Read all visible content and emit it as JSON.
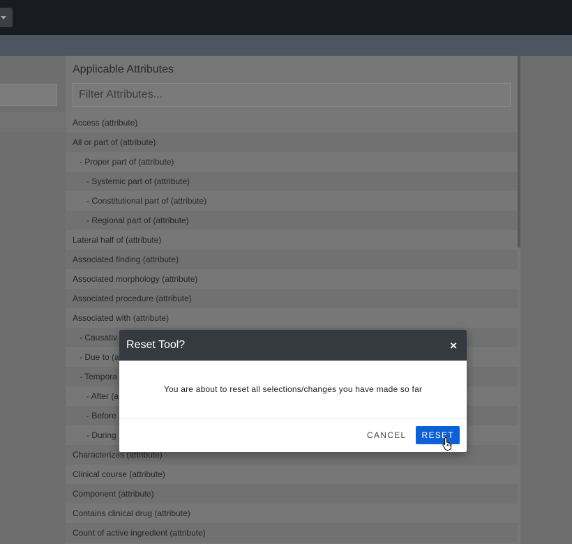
{
  "panel": {
    "title": "Applicable Attributes",
    "filter_placeholder": "Filter Attributes...",
    "items": [
      {
        "label": "Access (attribute)",
        "level": 0
      },
      {
        "label": "All or part of (attribute)",
        "level": 0
      },
      {
        "label": "- Proper part of (attribute)",
        "level": 1
      },
      {
        "label": "- Systemic part of (attribute)",
        "level": 2
      },
      {
        "label": "- Constitutional part of (attribute)",
        "level": 2
      },
      {
        "label": "- Regional part of (attribute)",
        "level": 2
      },
      {
        "label": "Lateral half of (attribute)",
        "level": 0
      },
      {
        "label": "Associated finding (attribute)",
        "level": 0
      },
      {
        "label": "Associated morphology (attribute)",
        "level": 0
      },
      {
        "label": "Associated procedure (attribute)",
        "level": 0
      },
      {
        "label": "Associated with (attribute)",
        "level": 0
      },
      {
        "label": "- Causativ",
        "level": 1
      },
      {
        "label": "- Due to (a",
        "level": 1
      },
      {
        "label": "- Tempora",
        "level": 1
      },
      {
        "label": "- After (a",
        "level": 2
      },
      {
        "label": "- Before",
        "level": 2
      },
      {
        "label": "- During",
        "level": 2
      },
      {
        "label": "Characterizes (attribute)",
        "level": 0
      },
      {
        "label": "Clinical course (attribute)",
        "level": 0
      },
      {
        "label": "Component (attribute)",
        "level": 0
      },
      {
        "label": "Contains clinical drug (attribute)",
        "level": 0
      },
      {
        "label": "Count of active ingredient (attribute)",
        "level": 0
      }
    ]
  },
  "modal": {
    "title": "Reset Tool?",
    "close_label": "×",
    "message": "You are about to reset all selections/changes you have made so far",
    "cancel_label": "CANCEL",
    "reset_label": "RESET"
  },
  "colors": {
    "modal_header": "#343a40",
    "primary": "#0b61d6"
  }
}
